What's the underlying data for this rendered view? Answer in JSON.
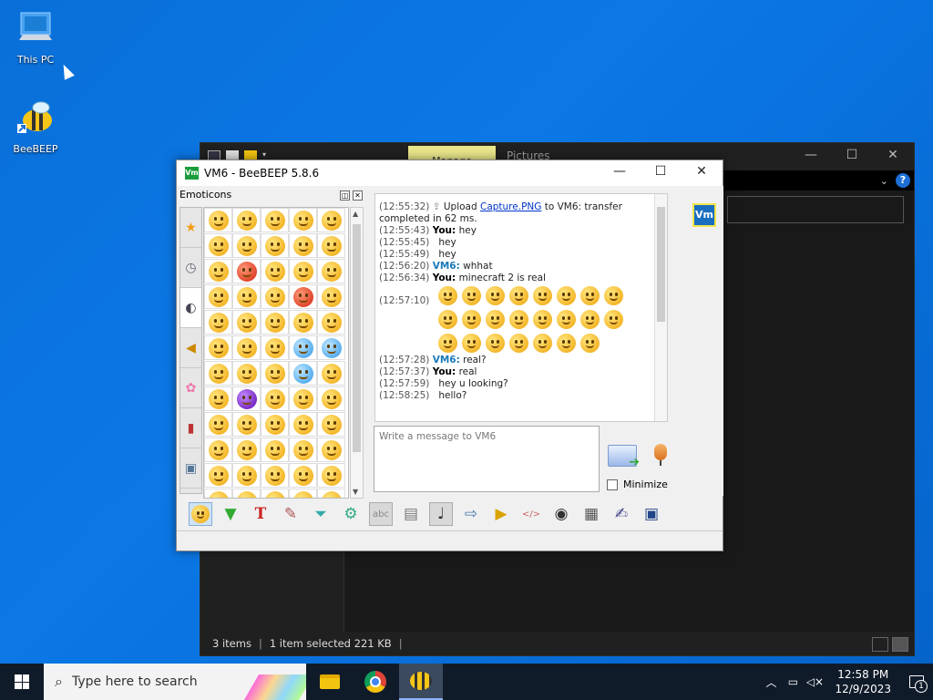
{
  "desktop": {
    "icons": [
      {
        "label": "This PC",
        "icon": "computer-icon"
      },
      {
        "label": "BeeBEEP",
        "icon": "bee-icon"
      }
    ]
  },
  "explorer": {
    "ribbon_tab_manage": "Manage",
    "title": "Pictures",
    "status": {
      "items": "3 items",
      "selected": "1 item selected  221 KB"
    }
  },
  "beebeep": {
    "title": "VM6 - BeeBEEP 5.8.6",
    "app_icon_text": "Vm",
    "emoticons_label": "Emoticons",
    "chat": [
      {
        "ts": "(12:55:32)",
        "kind": "upload",
        "pre": "Upload ",
        "link": "Capture.PNG",
        "post": " to VM6: transfer completed in 62 ms."
      },
      {
        "ts": "(12:55:43)",
        "kind": "you",
        "who": "You:",
        "text": "hey"
      },
      {
        "ts": "(12:55:45)",
        "kind": "cont",
        "text": "hey"
      },
      {
        "ts": "(12:55:49)",
        "kind": "cont",
        "text": "hey"
      },
      {
        "ts": "(12:56:20)",
        "kind": "vm",
        "who": "VM6:",
        "text": "whhat"
      },
      {
        "ts": "(12:56:34)",
        "kind": "you",
        "who": "You:",
        "text": "minecraft 2 is real"
      },
      {
        "ts": "(12:57:10)",
        "kind": "emoji",
        "count": 23
      },
      {
        "ts": "(12:57:28)",
        "kind": "vm",
        "who": "VM6:",
        "text": "real?"
      },
      {
        "ts": "(12:57:37)",
        "kind": "you",
        "who": "You:",
        "text": "real"
      },
      {
        "ts": "(12:57:59)",
        "kind": "cont",
        "text": "hey u looking?"
      },
      {
        "ts": "(12:58:25)",
        "kind": "cont",
        "text": "hello?"
      }
    ],
    "input_placeholder": "Write a message to VM6",
    "minimize_label": "Minimize",
    "contact_badge": "Vm"
  },
  "taskbar": {
    "search_placeholder": "Type here to search",
    "time": "12:58 PM",
    "date": "12/9/2023",
    "notification_count": "1"
  }
}
